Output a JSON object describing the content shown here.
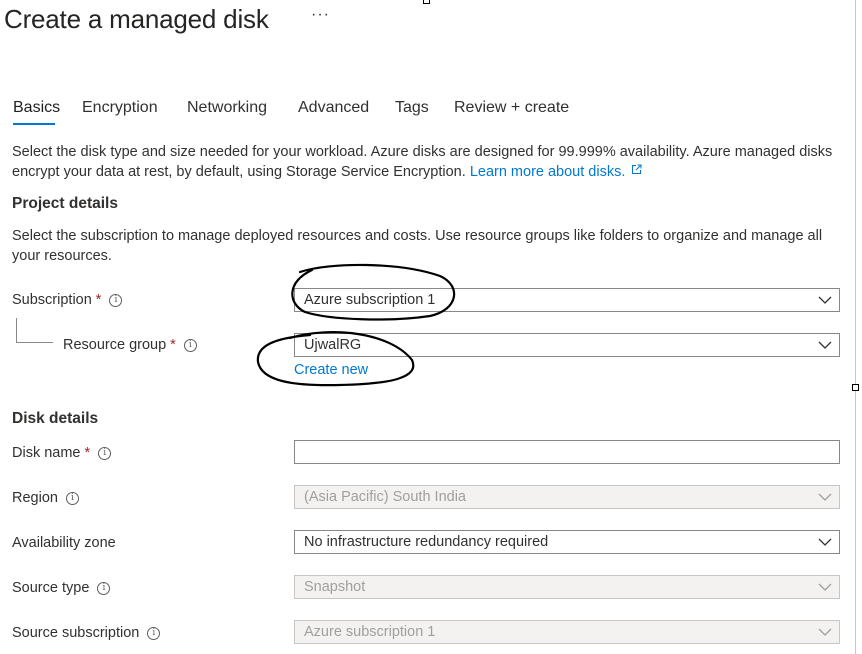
{
  "page": {
    "title": "Create a managed disk",
    "more_label": "···"
  },
  "tabs": [
    {
      "label": "Basics",
      "active": true
    },
    {
      "label": "Encryption"
    },
    {
      "label": "Networking"
    },
    {
      "label": "Advanced"
    },
    {
      "label": "Tags"
    },
    {
      "label": "Review + create"
    }
  ],
  "intro": {
    "text": "Select the disk type and size needed for your workload. Azure disks are designed for 99.999% availability. Azure managed disks encrypt your data at rest, by default, using Storage Service Encryption.",
    "link": "Learn more about disks."
  },
  "project": {
    "heading": "Project details",
    "desc": "Select the subscription to manage deployed resources and costs. Use resource groups like folders to organize and manage all your resources.",
    "subscription": {
      "label": "Subscription",
      "value": "Azure subscription 1"
    },
    "resource_group": {
      "label": "Resource group",
      "value": "UjwalRG",
      "create_new": "Create new"
    }
  },
  "disk": {
    "heading": "Disk details",
    "name": {
      "label": "Disk name",
      "value": ""
    },
    "region": {
      "label": "Region",
      "value": "(Asia Pacific) South India"
    },
    "zone": {
      "label": "Availability zone",
      "value": "No infrastructure redundancy required"
    },
    "source_type": {
      "label": "Source type",
      "value": "Snapshot"
    },
    "source_subscription": {
      "label": "Source subscription",
      "value": "Azure subscription 1"
    }
  },
  "required_marker": "*",
  "info_glyph": "i",
  "colors": {
    "accent": "#0078d4",
    "required": "#a4262c",
    "annotation": "#000000"
  }
}
